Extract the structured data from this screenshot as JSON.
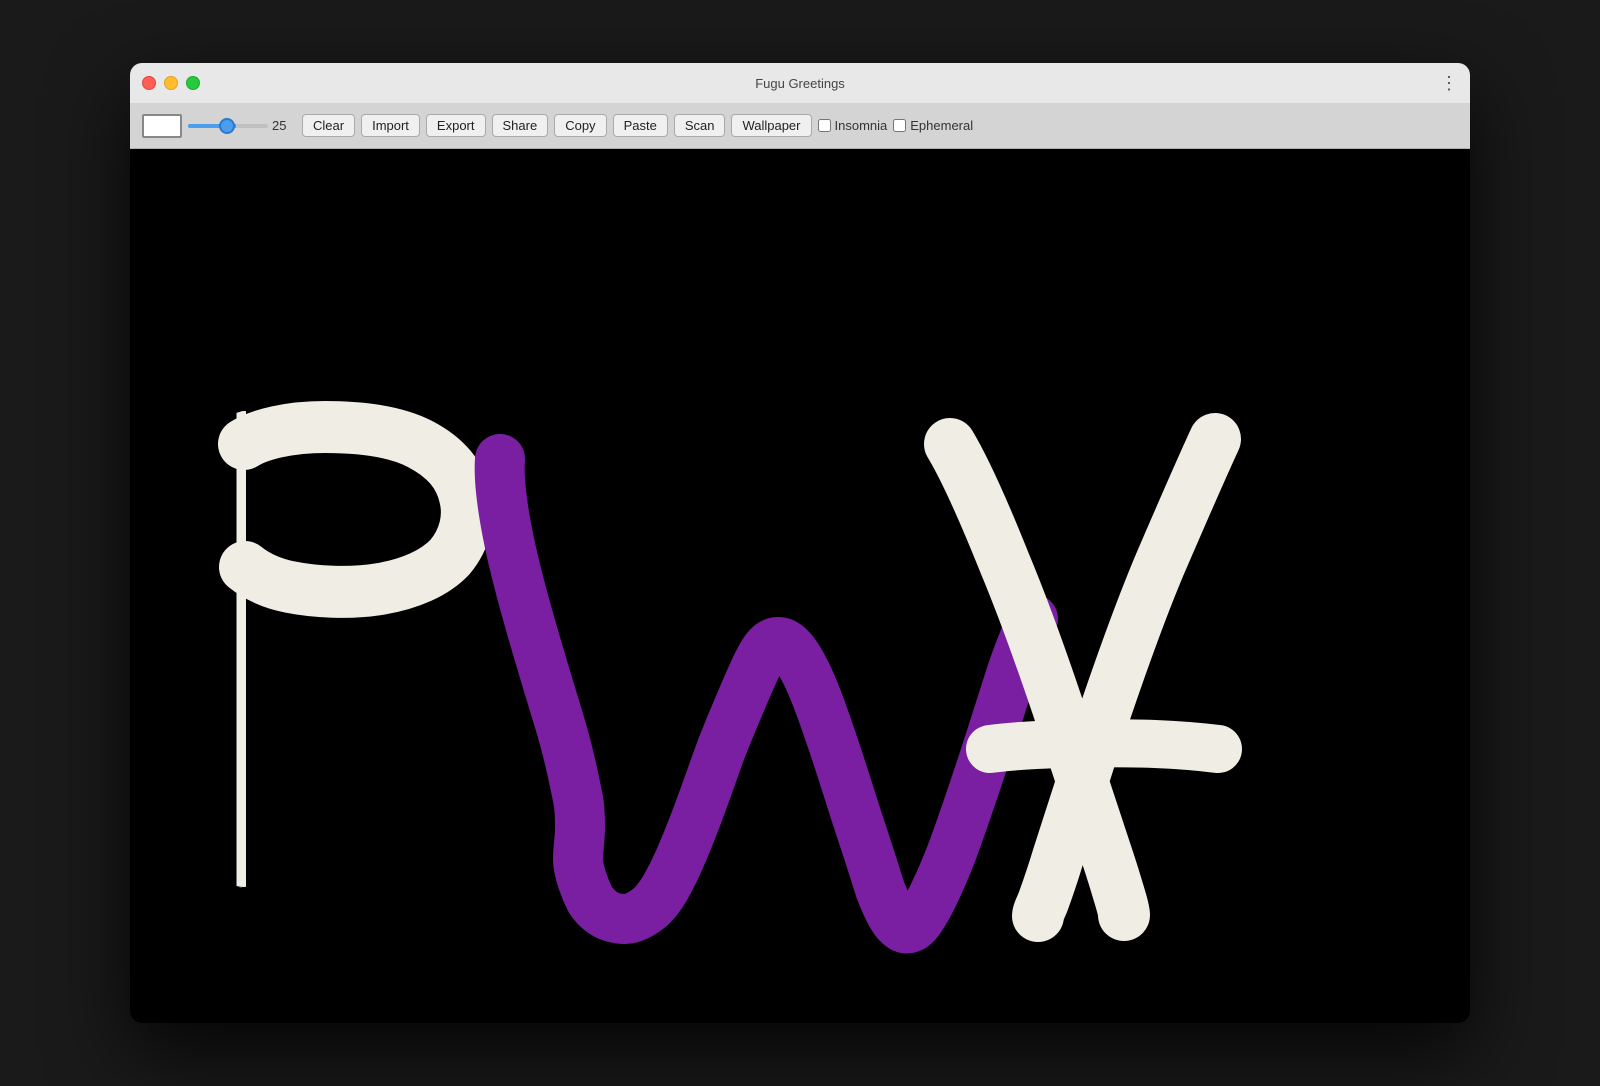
{
  "window": {
    "title": "Fugu Greetings"
  },
  "toolbar": {
    "brush_size_value": "25",
    "buttons": [
      {
        "id": "clear",
        "label": "Clear"
      },
      {
        "id": "import",
        "label": "Import"
      },
      {
        "id": "export",
        "label": "Export"
      },
      {
        "id": "share",
        "label": "Share"
      },
      {
        "id": "copy",
        "label": "Copy"
      },
      {
        "id": "paste",
        "label": "Paste"
      },
      {
        "id": "scan",
        "label": "Scan"
      },
      {
        "id": "wallpaper",
        "label": "Wallpaper"
      }
    ],
    "checkboxes": [
      {
        "id": "insomnia",
        "label": "Insomnia"
      },
      {
        "id": "ephemeral",
        "label": "Ephemeral"
      }
    ]
  },
  "colors": {
    "accent_blue": "#4a9eed",
    "purple": "#7B1FA2",
    "white_stroke": "#f5f5f0"
  }
}
